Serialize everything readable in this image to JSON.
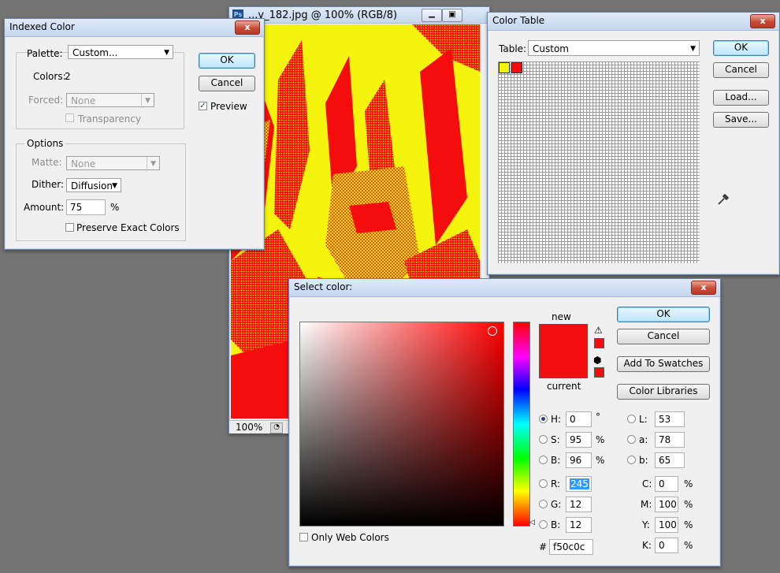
{
  "image_window": {
    "title": "...y_182.jpg @ 100% (RGB/8)",
    "zoom": "100%",
    "colors": {
      "yellow": "#f4f40c",
      "red": "#f50c0c"
    }
  },
  "indexed_color": {
    "title": "Indexed Color",
    "close": "x",
    "palette_label": "Palette:",
    "palette_value": "Custom...",
    "colors_label": "Colors:",
    "colors_value": "2",
    "forced_label": "Forced:",
    "forced_value": "None",
    "transparency_label": "Transparency",
    "options_title": "Options",
    "matte_label": "Matte:",
    "matte_value": "None",
    "dither_label": "Dither:",
    "dither_value": "Diffusion",
    "amount_label": "Amount:",
    "amount_value": "75",
    "amount_unit": "%",
    "preserve_label": "Preserve Exact Colors",
    "ok": "OK",
    "cancel": "Cancel",
    "preview_label": "Preview",
    "preview_checked": true
  },
  "color_table": {
    "title": "Color Table",
    "close": "x",
    "table_label": "Table:",
    "table_value": "Custom",
    "ok": "OK",
    "cancel": "Cancel",
    "load": "Load...",
    "save": "Save...",
    "entries": [
      "#f4f40c",
      "#f50c0c"
    ]
  },
  "select_color": {
    "title": "Select color:",
    "close": "x",
    "new_label": "new",
    "current_label": "current",
    "ok": "OK",
    "cancel": "Cancel",
    "add_swatches": "Add To Swatches",
    "color_libraries": "Color Libraries",
    "h_label": "H:",
    "h_value": "0",
    "h_unit": "°",
    "s_label": "S:",
    "s_value": "95",
    "s_unit": "%",
    "b_label": "B:",
    "b_value": "96",
    "b_unit": "%",
    "r_label": "R:",
    "r_value": "245",
    "g_label": "G:",
    "g_value": "12",
    "bl_label": "B:",
    "bl_value": "12",
    "l_label": "L:",
    "l_value": "53",
    "a_label": "a:",
    "a_value": "78",
    "lb_label": "b:",
    "lb_value": "65",
    "c_label": "C:",
    "c_value": "0",
    "c_unit": "%",
    "m_label": "M:",
    "m_value": "100",
    "m_unit": "%",
    "y_label": "Y:",
    "y_value": "100",
    "y_unit": "%",
    "k_label": "K:",
    "k_value": "0",
    "k_unit": "%",
    "hex_label": "#",
    "hex_value": "f50c0c",
    "web_colors_label": "Only Web Colors",
    "new_color": "#f50c0c",
    "current_color": "#f50c0c"
  }
}
